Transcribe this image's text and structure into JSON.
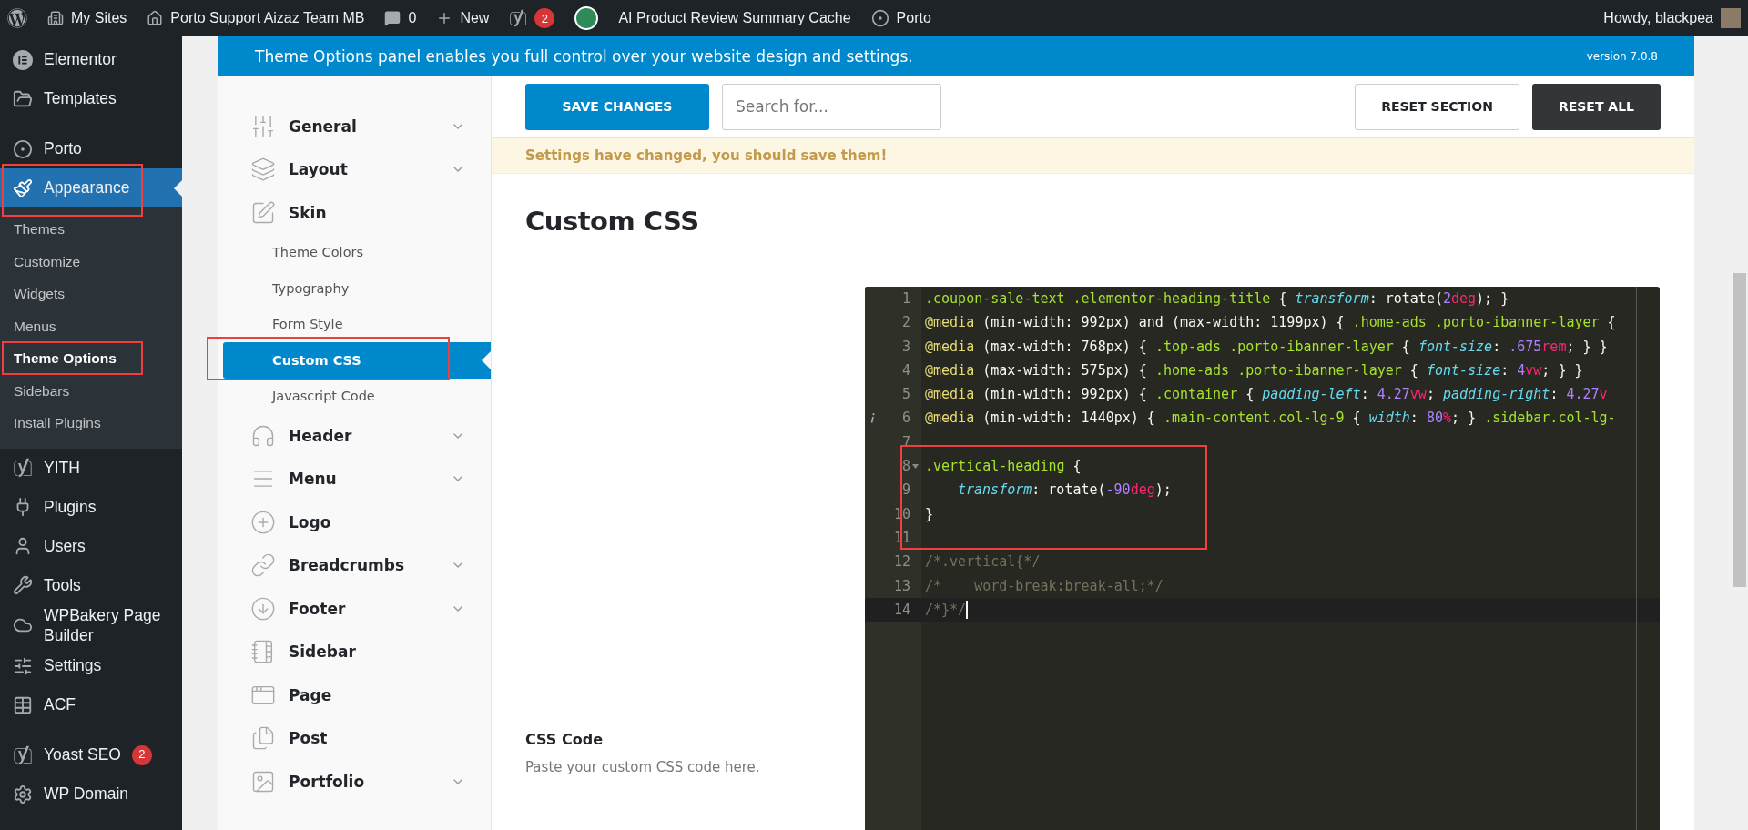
{
  "admin_bar": {
    "my_sites": "My Sites",
    "site_name": "Porto Support Aizaz Team MB",
    "comments": "0",
    "new": "New",
    "yoast_badge": "2",
    "cache": "AI Product Review Summary Cache",
    "porto": "Porto",
    "greeting": "Howdy, blackpea"
  },
  "wp_menu": [
    {
      "label": "Elementor",
      "current": false,
      "boxed": false
    },
    {
      "label": "Templates",
      "current": false,
      "boxed": false
    },
    {
      "label": "Porto",
      "current": false,
      "boxed": false
    },
    {
      "label": "Appearance",
      "current": true,
      "boxed": true,
      "children": [
        {
          "label": "Themes",
          "current": false,
          "boxed": false
        },
        {
          "label": "Customize",
          "current": false,
          "boxed": false
        },
        {
          "label": "Widgets",
          "current": false,
          "boxed": false
        },
        {
          "label": "Menus",
          "current": false,
          "boxed": false
        },
        {
          "label": "Theme Options",
          "current": true,
          "boxed": true
        },
        {
          "label": "Sidebars",
          "current": false,
          "boxed": false
        },
        {
          "label": "Install Plugins",
          "current": false,
          "boxed": false
        }
      ]
    },
    {
      "label": "YITH",
      "current": false,
      "boxed": false
    },
    {
      "label": "Plugins",
      "current": false,
      "boxed": false
    },
    {
      "label": "Users",
      "current": false,
      "boxed": false
    },
    {
      "label": "Tools",
      "current": false,
      "boxed": false
    },
    {
      "label": "WPBakery Page Builder",
      "current": false,
      "boxed": false
    },
    {
      "label": "Settings",
      "current": false,
      "boxed": false
    },
    {
      "label": "ACF",
      "current": false,
      "boxed": false
    },
    {
      "label": "Yoast SEO",
      "current": false,
      "boxed": false,
      "badge": "2"
    },
    {
      "label": "WP Domain",
      "current": false,
      "boxed": false
    }
  ],
  "banner": {
    "text": "Theme Options panel enables you full control over your website design and settings.",
    "version": "version 7.0.8"
  },
  "options_nav": [
    {
      "label": "General",
      "expandable": true
    },
    {
      "label": "Layout",
      "expandable": true
    },
    {
      "label": "Skin",
      "expandable": false,
      "children": [
        {
          "label": "Theme Colors",
          "selected": false,
          "boxed": false
        },
        {
          "label": "Typography",
          "selected": false,
          "boxed": false
        },
        {
          "label": "Form Style",
          "selected": false,
          "boxed": false
        },
        {
          "label": "Custom CSS",
          "selected": true,
          "boxed": true
        },
        {
          "label": "Javascript Code",
          "selected": false,
          "boxed": false
        }
      ]
    },
    {
      "label": "Header",
      "expandable": true
    },
    {
      "label": "Menu",
      "expandable": true
    },
    {
      "label": "Logo",
      "expandable": false
    },
    {
      "label": "Breadcrumbs",
      "expandable": true
    },
    {
      "label": "Footer",
      "expandable": true
    },
    {
      "label": "Sidebar",
      "expandable": false
    },
    {
      "label": "Page",
      "expandable": false
    },
    {
      "label": "Post",
      "expandable": false
    },
    {
      "label": "Portfolio",
      "expandable": true
    }
  ],
  "toolbar": {
    "save": "SAVE CHANGES",
    "search": {
      "placeholder": "Search for..."
    },
    "reset_section": "RESET SECTION",
    "reset_all": "RESET ALL"
  },
  "notice": "Settings have changed, you should save them!",
  "section_title": "Custom CSS",
  "field": {
    "label": "CSS Code",
    "description": "Paste your custom CSS code here."
  },
  "editor": {
    "lines": [
      {
        "number": "1",
        "boxed": false,
        "active": false,
        "segments": [
          {
            "kind": "sel",
            "text": ".coupon-sale-text .elementor-heading-title"
          },
          {
            "kind": "plain",
            "text": " { "
          },
          {
            "kind": "prop",
            "text": "transform"
          },
          {
            "kind": "plain",
            "text": ": rotate("
          },
          {
            "kind": "num",
            "text": "2"
          },
          {
            "kind": "unit",
            "text": "deg"
          },
          {
            "kind": "plain",
            "text": "); }"
          }
        ]
      },
      {
        "number": "2",
        "boxed": false,
        "active": false,
        "segments": [
          {
            "kind": "at",
            "text": "@media"
          },
          {
            "kind": "plain",
            "text": " (min-width: 992px) and (max-width: 1199px) { "
          },
          {
            "kind": "sel",
            "text": ".home-ads .porto-ibanner-layer"
          },
          {
            "kind": "plain",
            "text": " {"
          }
        ]
      },
      {
        "number": "3",
        "boxed": false,
        "active": false,
        "segments": [
          {
            "kind": "at",
            "text": "@media"
          },
          {
            "kind": "plain",
            "text": " (max-width: 768px) { "
          },
          {
            "kind": "sel",
            "text": ".top-ads .porto-ibanner-layer"
          },
          {
            "kind": "plain",
            "text": " { "
          },
          {
            "kind": "prop",
            "text": "font-size"
          },
          {
            "kind": "plain",
            "text": ": "
          },
          {
            "kind": "num",
            "text": ".675"
          },
          {
            "kind": "unit",
            "text": "rem"
          },
          {
            "kind": "plain",
            "text": "; } }"
          }
        ]
      },
      {
        "number": "4",
        "boxed": false,
        "active": false,
        "segments": [
          {
            "kind": "at",
            "text": "@media"
          },
          {
            "kind": "plain",
            "text": " (max-width: 575px) { "
          },
          {
            "kind": "sel",
            "text": ".home-ads .porto-ibanner-layer"
          },
          {
            "kind": "plain",
            "text": " { "
          },
          {
            "kind": "prop",
            "text": "font-size"
          },
          {
            "kind": "plain",
            "text": ": "
          },
          {
            "kind": "num",
            "text": "4"
          },
          {
            "kind": "unit",
            "text": "vw"
          },
          {
            "kind": "plain",
            "text": "; } }"
          }
        ]
      },
      {
        "number": "5",
        "boxed": false,
        "active": false,
        "segments": [
          {
            "kind": "at",
            "text": "@media"
          },
          {
            "kind": "plain",
            "text": " (min-width: 992px) { "
          },
          {
            "kind": "sel",
            "text": ".container"
          },
          {
            "kind": "plain",
            "text": " { "
          },
          {
            "kind": "prop",
            "text": "padding-left"
          },
          {
            "kind": "plain",
            "text": ": "
          },
          {
            "kind": "num",
            "text": "4.27"
          },
          {
            "kind": "unit",
            "text": "vw"
          },
          {
            "kind": "plain",
            "text": "; "
          },
          {
            "kind": "prop",
            "text": "padding-right"
          },
          {
            "kind": "plain",
            "text": ": "
          },
          {
            "kind": "num",
            "text": "4.27"
          },
          {
            "kind": "unit",
            "text": "v"
          }
        ]
      },
      {
        "number": "6",
        "info": true,
        "boxed": false,
        "active": false,
        "segments": [
          {
            "kind": "at",
            "text": "@media"
          },
          {
            "kind": "plain",
            "text": " (min-width: 1440px) { "
          },
          {
            "kind": "sel",
            "text": ".main-content.col-lg-9"
          },
          {
            "kind": "plain",
            "text": " { "
          },
          {
            "kind": "prop",
            "text": "width"
          },
          {
            "kind": "plain",
            "text": ": "
          },
          {
            "kind": "num",
            "text": "80"
          },
          {
            "kind": "unit",
            "text": "%"
          },
          {
            "kind": "plain",
            "text": "; } "
          },
          {
            "kind": "sel",
            "text": ".sidebar.col-lg-"
          }
        ]
      },
      {
        "number": "7",
        "boxed": false,
        "active": false
      },
      {
        "number": "8",
        "foldable": true,
        "boxed": true,
        "active": false,
        "segments": [
          {
            "kind": "sel",
            "text": ".vertical-heading"
          },
          {
            "kind": "plain",
            "text": " {"
          }
        ]
      },
      {
        "number": "9",
        "boxed": true,
        "active": false,
        "indent": true,
        "segments": [
          {
            "kind": "prop",
            "text": "transform"
          },
          {
            "kind": "plain",
            "text": ": rotate("
          },
          {
            "kind": "num",
            "text": "-90"
          },
          {
            "kind": "unit",
            "text": "deg"
          },
          {
            "kind": "plain",
            "text": ");"
          }
        ]
      },
      {
        "number": "10",
        "boxed": true,
        "active": false,
        "segments": [
          {
            "kind": "plain",
            "text": "}"
          }
        ]
      },
      {
        "number": "11",
        "boxed": true,
        "active": false
      },
      {
        "number": "12",
        "boxed": false,
        "active": false,
        "segments": [
          {
            "kind": "comment",
            "text": "/*.vertical{*/"
          }
        ]
      },
      {
        "number": "13",
        "boxed": false,
        "active": false,
        "segments": [
          {
            "kind": "comment",
            "text": "/*    word-break:break-all;*/"
          }
        ]
      },
      {
        "number": "14",
        "boxed": false,
        "active": true,
        "segments": [
          {
            "kind": "comment",
            "text": "/*}*/"
          }
        ]
      }
    ]
  }
}
